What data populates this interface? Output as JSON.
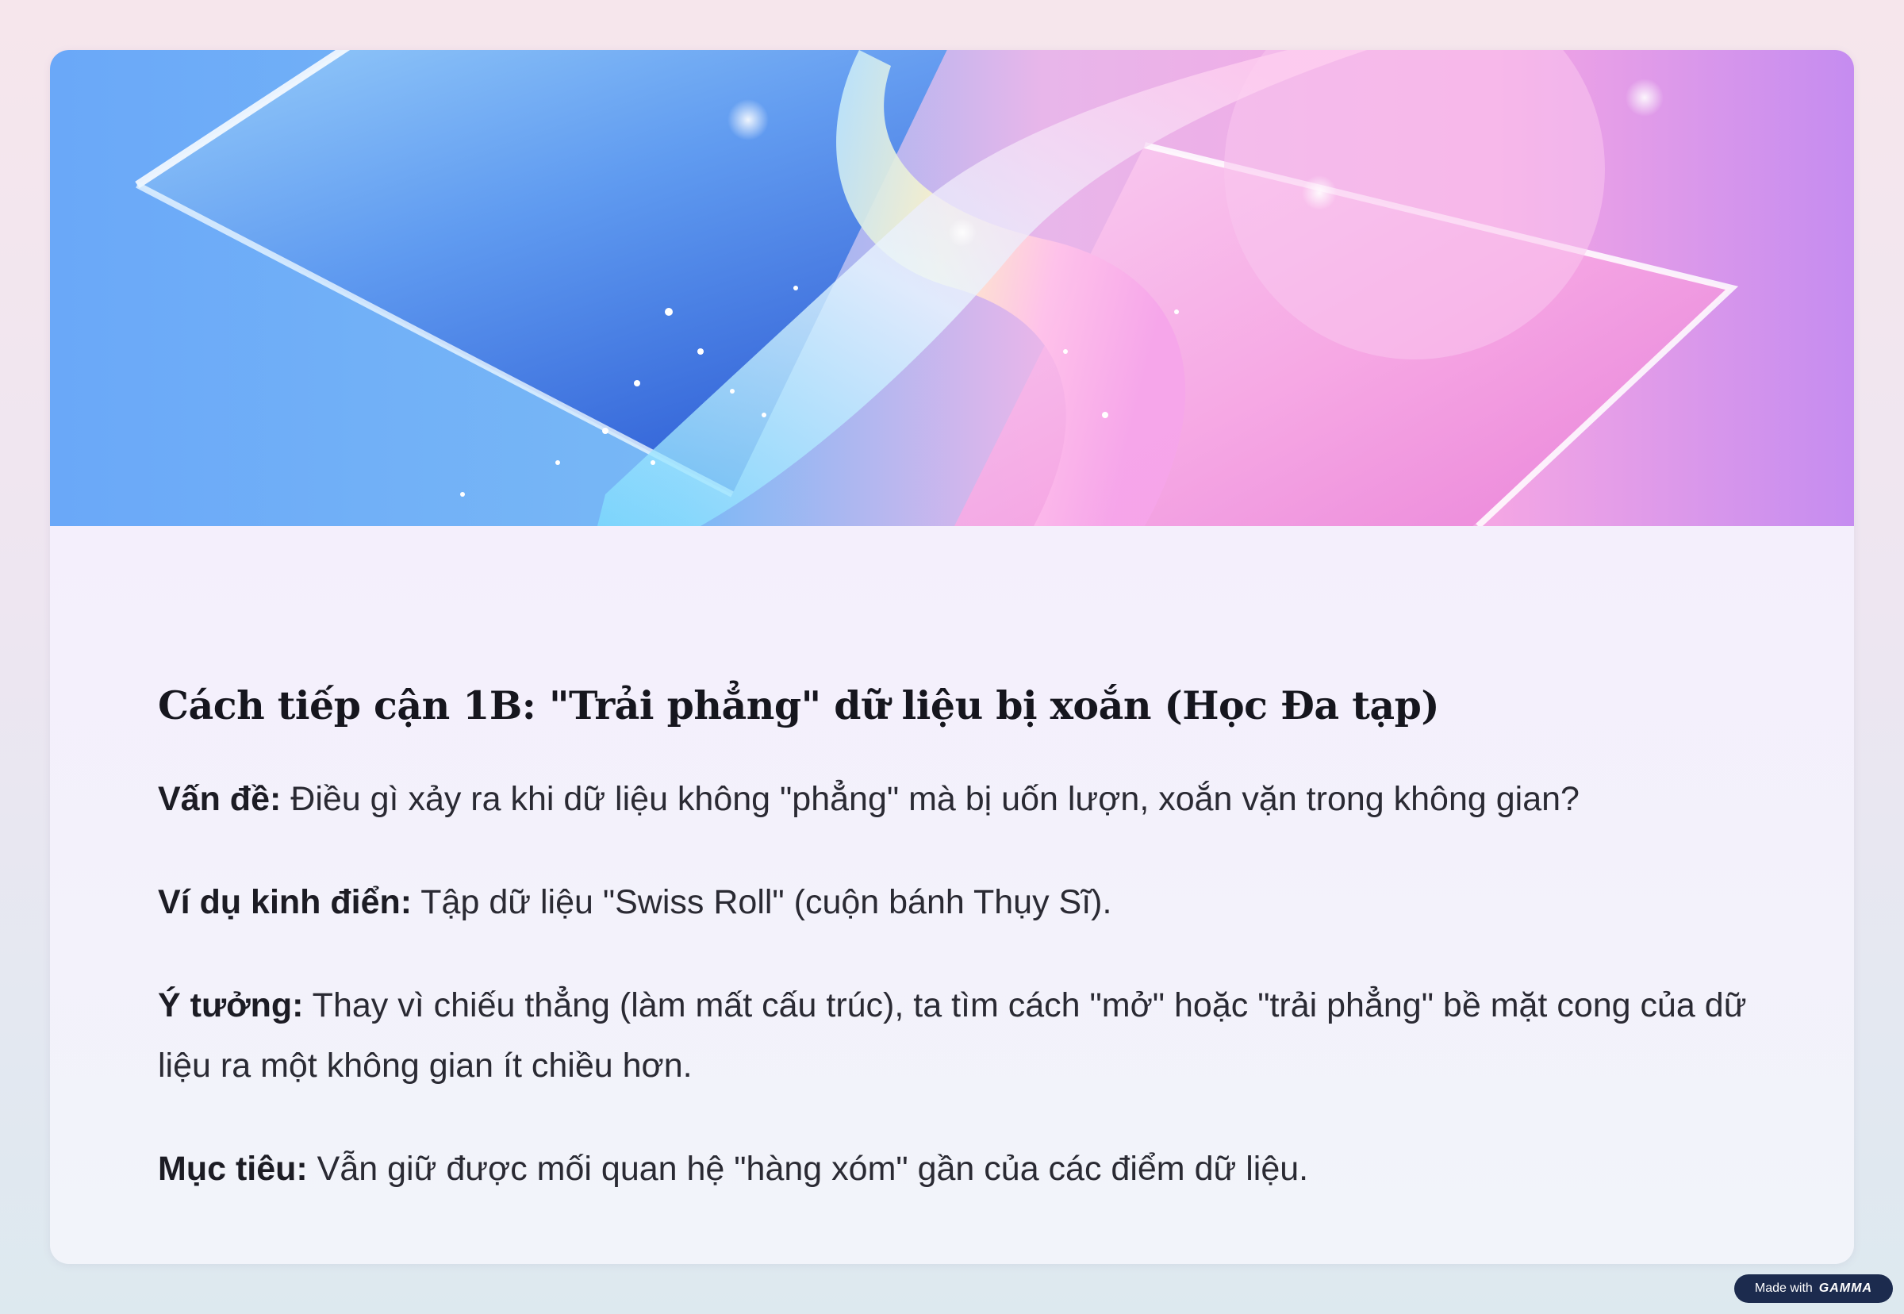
{
  "slide": {
    "title": "Cách tiếp cận 1B: \"Trải phẳng\" dữ liệu bị xoắn (Học Đa tạp)",
    "paragraphs": [
      {
        "label": "Vấn đề:",
        "text": " Điều gì xảy ra khi dữ liệu không \"phẳng\" mà bị uốn lượn, xoắn vặn trong không gian?"
      },
      {
        "label": "Ví dụ kinh điển:",
        "text": " Tập dữ liệu \"Swiss Roll\" (cuộn bánh Thụy Sĩ)."
      },
      {
        "label": "Ý tưởng:",
        "text": " Thay vì chiếu thẳng (làm mất cấu trúc), ta tìm cách \"mở\" hoặc \"trải phẳng\" bề mặt cong của dữ liệu ra một không gian ít chiều hơn."
      },
      {
        "label": "Mục tiêu:",
        "text": " Vẫn giữ được mối quan hệ \"hàng xóm\" gần của các điểm dữ liệu."
      }
    ]
  },
  "badge": {
    "prefix": "Made with",
    "brand": "GAMMA"
  },
  "colors": {
    "hero_blue": "#5b8ff0",
    "hero_pink": "#f08ad8",
    "hero_purple": "#c58cf0",
    "badge_bg": "#1c2b4e"
  }
}
